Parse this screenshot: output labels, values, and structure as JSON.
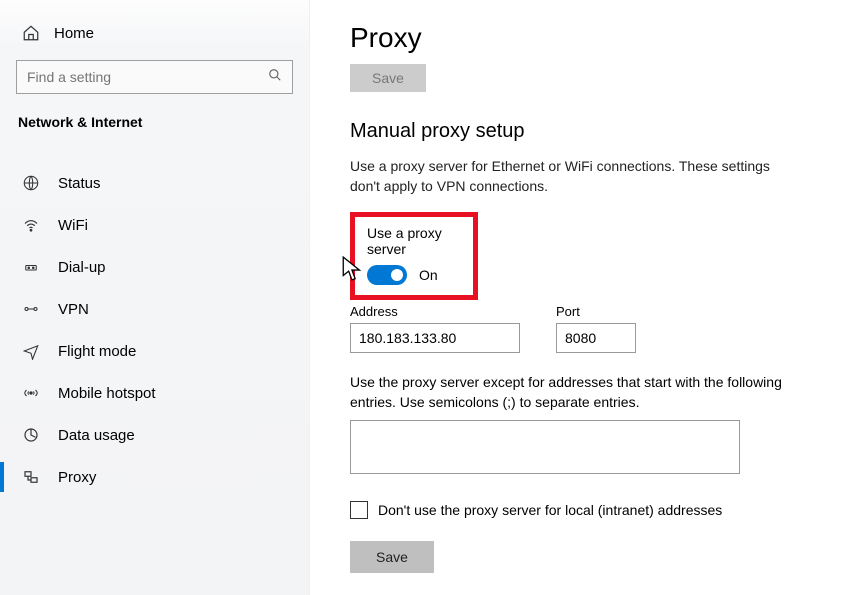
{
  "sidebar": {
    "home_label": "Home",
    "search_placeholder": "Find a setting",
    "category": "Network & Internet",
    "items": [
      {
        "label": "Status"
      },
      {
        "label": "WiFi"
      },
      {
        "label": "Dial-up"
      },
      {
        "label": "VPN"
      },
      {
        "label": "Flight mode"
      },
      {
        "label": "Mobile hotspot"
      },
      {
        "label": "Data usage"
      },
      {
        "label": "Proxy"
      }
    ]
  },
  "main": {
    "page_title": "Proxy",
    "save_label_top": "Save",
    "section_heading": "Manual proxy setup",
    "description": "Use a proxy server for Ethernet or WiFi connections. These settings don't apply to VPN connections.",
    "use_proxy_label": "Use a proxy server",
    "toggle_state_label": "On",
    "address_label": "Address",
    "address_value": "180.183.133.80",
    "port_label": "Port",
    "port_value": "8080",
    "except_label": "Use the proxy server except for addresses that start with the following entries. Use semicolons (;) to separate entries.",
    "except_value": "",
    "local_bypass_label": "Don't use the proxy server for local (intranet) addresses",
    "save_label_bottom": "Save"
  }
}
